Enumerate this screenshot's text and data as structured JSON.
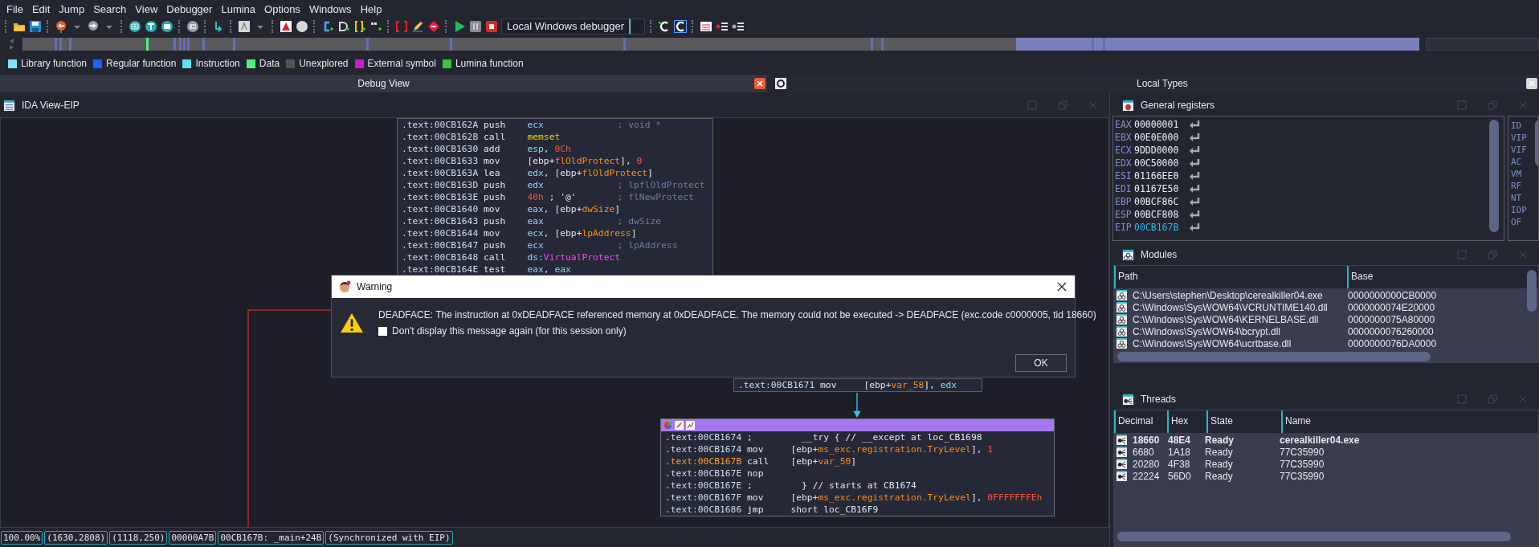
{
  "menu": [
    "File",
    "Edit",
    "Jump",
    "Search",
    "View",
    "Debugger",
    "Lumina",
    "Options",
    "Windows",
    "Help"
  ],
  "toolbar": {
    "debugger": "Local Windows debugger"
  },
  "legend": [
    {
      "label": "Library function",
      "color": "#80e0ff"
    },
    {
      "label": "Regular function",
      "color": "#1e5fff"
    },
    {
      "label": "Instruction",
      "color": "#60e0f0"
    },
    {
      "label": "Data",
      "color": "#50f080"
    },
    {
      "label": "Unexplored",
      "color": "#555555"
    },
    {
      "label": "External symbol",
      "color": "#c820c8"
    },
    {
      "label": "Lumina function",
      "color": "#30c840"
    }
  ],
  "debug_view": {
    "title": "Debug View"
  },
  "local_types": {
    "title": "Local Types"
  },
  "ida_view": {
    "title": "IDA View-EIP",
    "blocks": [
      {
        "selected": false,
        "lines": [
          {
            "addr": ".text:00CB162A",
            "mnem": "push",
            "ops": [
              {
                "text": "ecx",
                "kind": "r"
              }
            ],
            "comment": "; void *",
            "current": false
          },
          {
            "addr": ".text:00CB162B",
            "mnem": "call",
            "ops": [
              {
                "text": "memset",
                "kind": "f"
              }
            ],
            "current": false
          },
          {
            "addr": ".text:00CB1630",
            "mnem": "add",
            "ops": [
              {
                "text": "esp",
                "kind": "r"
              },
              {
                "text": ", ",
                "kind": "p"
              },
              {
                "text": "0Ch",
                "kind": "n"
              }
            ],
            "current": false
          },
          {
            "addr": ".text:00CB1633",
            "mnem": "mov",
            "ops": [
              {
                "text": "[ebp+",
                "kind": "p"
              },
              {
                "text": "flOldProtect",
                "kind": "v"
              },
              {
                "text": "], ",
                "kind": "p"
              },
              {
                "text": "0",
                "kind": "n"
              }
            ],
            "current": false
          },
          {
            "addr": ".text:00CB163A",
            "mnem": "lea",
            "ops": [
              {
                "text": "edx",
                "kind": "r"
              },
              {
                "text": ", [ebp+",
                "kind": "p"
              },
              {
                "text": "flOldProtect",
                "kind": "v"
              },
              {
                "text": "]",
                "kind": "p"
              }
            ],
            "current": false
          },
          {
            "addr": ".text:00CB163D",
            "mnem": "push",
            "ops": [
              {
                "text": "edx",
                "kind": "r"
              }
            ],
            "comment": "; lpflOldProtect",
            "current": false
          },
          {
            "addr": ".text:00CB163E",
            "mnem": "push",
            "ops": [
              {
                "text": "40h",
                "kind": "n"
              },
              {
                "text": " ; '@'",
                "kind": "p"
              }
            ],
            "comment": "; flNewProtect",
            "current": false
          },
          {
            "addr": ".text:00CB1640",
            "mnem": "mov",
            "ops": [
              {
                "text": "eax",
                "kind": "r"
              },
              {
                "text": ", [ebp+",
                "kind": "p"
              },
              {
                "text": "dwSize",
                "kind": "v"
              },
              {
                "text": "]",
                "kind": "p"
              }
            ],
            "current": false
          },
          {
            "addr": ".text:00CB1643",
            "mnem": "push",
            "ops": [
              {
                "text": "eax",
                "kind": "r"
              }
            ],
            "comment": "; dwSize",
            "current": false
          },
          {
            "addr": ".text:00CB1644",
            "mnem": "mov",
            "ops": [
              {
                "text": "ecx",
                "kind": "r"
              },
              {
                "text": ", [ebp+",
                "kind": "p"
              },
              {
                "text": "lpAddress",
                "kind": "v"
              },
              {
                "text": "]",
                "kind": "p"
              }
            ],
            "current": false
          },
          {
            "addr": ".text:00CB1647",
            "mnem": "push",
            "ops": [
              {
                "text": "ecx",
                "kind": "r"
              }
            ],
            "comment": "; lpAddress",
            "current": false
          },
          {
            "addr": ".text:00CB1648",
            "mnem": "call",
            "ops": [
              {
                "text": "ds:",
                "kind": "r"
              },
              {
                "text": "VirtualProtect",
                "kind": "i"
              }
            ],
            "current": false
          },
          {
            "addr": ".text:00CB164E",
            "mnem": "test",
            "ops": [
              {
                "text": "eax",
                "kind": "r"
              },
              {
                "text": ", ",
                "kind": "p"
              },
              {
                "text": "eax",
                "kind": "r"
              }
            ],
            "current": false
          }
        ]
      },
      {
        "selected": false,
        "lines": [
          {
            "addr": ".text:00CB1671",
            "mnem": "mov",
            "ops": [
              {
                "text": "[ebp+",
                "kind": "p"
              },
              {
                "text": "var_58",
                "kind": "v"
              },
              {
                "text": "], ",
                "kind": "p"
              },
              {
                "text": "edx",
                "kind": "r"
              }
            ],
            "current": false
          }
        ]
      },
      {
        "selected": true,
        "lines": [
          {
            "addr": ".text:00CB1674",
            "mnem": ";",
            "ops": [
              {
                "text": "  __try { // __except at loc_CB1698",
                "kind": "p"
              }
            ],
            "current": false
          },
          {
            "addr": ".text:00CB1674",
            "mnem": "mov",
            "ops": [
              {
                "text": "[ebp+",
                "kind": "p"
              },
              {
                "text": "ms_exc.registration.TryLevel",
                "kind": "v"
              },
              {
                "text": "], ",
                "kind": "p"
              },
              {
                "text": "1",
                "kind": "n"
              }
            ],
            "current": false
          },
          {
            "addr": ".text:00CB167B",
            "mnem": "call",
            "ops": [
              {
                "text": "[ebp+",
                "kind": "p"
              },
              {
                "text": "var_50",
                "kind": "v"
              },
              {
                "text": "]",
                "kind": "p"
              }
            ],
            "current": true
          },
          {
            "addr": ".text:00CB167E",
            "mnem": "nop",
            "current": false
          },
          {
            "addr": ".text:00CB167E",
            "mnem": ";",
            "ops": [
              {
                "text": "  } // starts at CB1674",
                "kind": "p"
              }
            ],
            "current": false
          },
          {
            "addr": ".text:00CB167F",
            "mnem": "mov",
            "ops": [
              {
                "text": "[ebp+",
                "kind": "p"
              },
              {
                "text": "ms_exc.registration.TryLevel",
                "kind": "v"
              },
              {
                "text": "], ",
                "kind": "p"
              },
              {
                "text": "0FFFFFFFEh",
                "kind": "n"
              }
            ],
            "current": false
          },
          {
            "addr": ".text:00CB1686",
            "mnem": "jmp",
            "ops": [
              {
                "text": "short loc_CB16F9",
                "kind": "p"
              }
            ],
            "current": false
          }
        ]
      }
    ]
  },
  "dialog": {
    "title": "Warning",
    "message": "DEADFACE: The instruction at 0xDEADFACE referenced memory at 0xDEADFACE. The memory could not be executed -> DEADFACE (exc.code c0000005, tid 18660)",
    "checkbox": {
      "label": "Don't display this message again (for this session only)",
      "checked": false
    },
    "button": "OK"
  },
  "status_bar": [
    "100.00%",
    "(1630,2808)",
    "(1118,250)",
    "00000A7B",
    "00CB167B: _main+24B",
    "(Synchronized with EIP)"
  ],
  "registers": {
    "title": "General registers",
    "rows": [
      {
        "name": "EAX",
        "value": "00000001",
        "changed": false
      },
      {
        "name": "EBX",
        "value": "00E0E000",
        "changed": false
      },
      {
        "name": "ECX",
        "value": "9DDD0000",
        "changed": false
      },
      {
        "name": "EDX",
        "value": "00C50000",
        "changed": false
      },
      {
        "name": "ESI",
        "value": "01166EE0",
        "changed": false
      },
      {
        "name": "EDI",
        "value": "01167E50",
        "changed": false
      },
      {
        "name": "EBP",
        "value": "00BCF86C",
        "changed": false
      },
      {
        "name": "ESP",
        "value": "00BCF808",
        "changed": false
      },
      {
        "name": "EIP",
        "value": "00CB167B",
        "changed": true
      }
    ],
    "flags": [
      "ID",
      "VIP",
      "VIF",
      "AC",
      "VM",
      "RF",
      "NT",
      "IOP",
      "OF"
    ]
  },
  "modules": {
    "title": "Modules",
    "columns": [
      "Path",
      "Base"
    ],
    "rows": [
      {
        "path": "C:\\Users\\stephen\\Desktop\\cerealkiller04.exe",
        "base": "0000000000CB0000"
      },
      {
        "path": "C:\\Windows\\SysWOW64\\VCRUNTIME140.dll",
        "base": "0000000074E20000"
      },
      {
        "path": "C:\\Windows\\SysWOW64\\KERNELBASE.dll",
        "base": "0000000075A80000"
      },
      {
        "path": "C:\\Windows\\SysWOW64\\bcrypt.dll",
        "base": "0000000076260000"
      },
      {
        "path": "C:\\Windows\\SysWOW64\\ucrtbase.dll",
        "base": "0000000076DA0000"
      }
    ]
  },
  "threads": {
    "title": "Threads",
    "columns": [
      "Decimal",
      "Hex",
      "State",
      "Name"
    ],
    "rows": [
      {
        "decimal": "18660",
        "hex": "48E4",
        "state": "Ready",
        "name": "cerealkiller04.exe",
        "current": true
      },
      {
        "decimal": "6680",
        "hex": "1A18",
        "state": "Ready",
        "name": "77C35990",
        "current": false
      },
      {
        "decimal": "20280",
        "hex": "4F38",
        "state": "Ready",
        "name": "77C35990",
        "current": false
      },
      {
        "decimal": "22224",
        "hex": "56D0",
        "state": "Ready",
        "name": "77C35990",
        "current": false
      }
    ]
  }
}
